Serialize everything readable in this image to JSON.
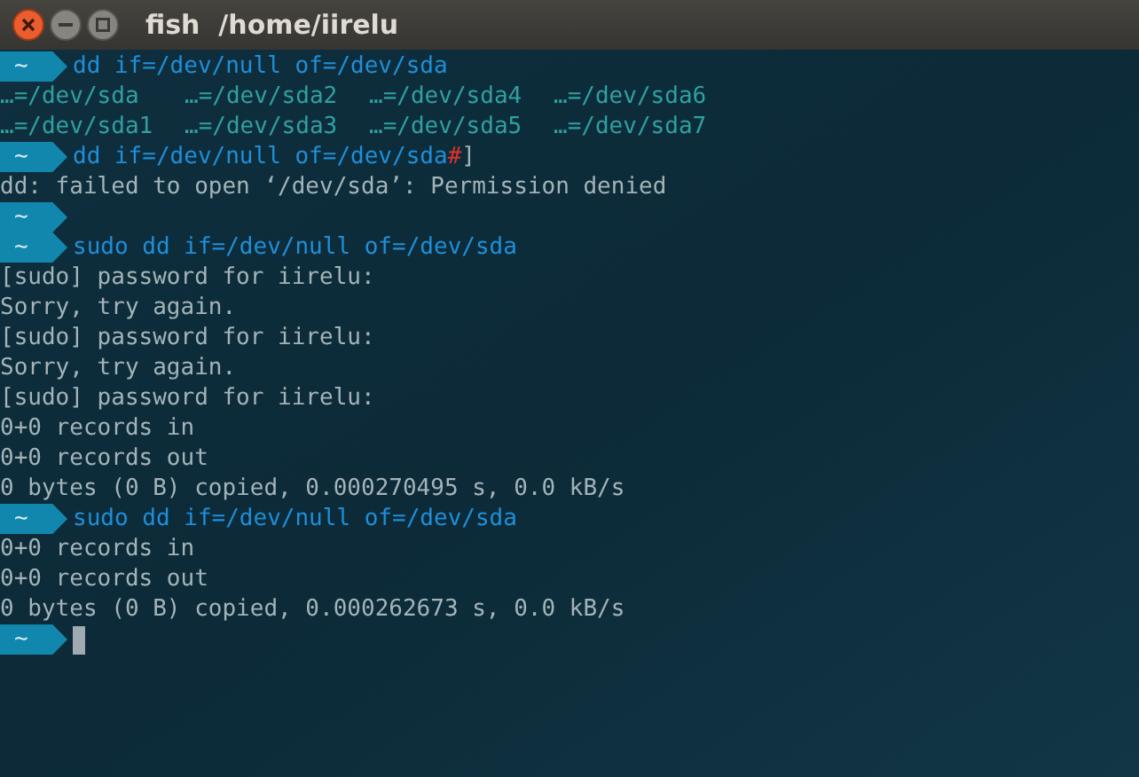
{
  "window": {
    "title": "fish  /home/iirelu"
  },
  "lines": [
    {
      "kind": "prompt",
      "dir": "~",
      "parts": [
        {
          "kind": "command",
          "text": "dd if=/dev/null of=/dev/sda"
        }
      ]
    },
    {
      "kind": "completions",
      "items": [
        "…=/dev/sda",
        "…=/dev/sda2",
        "…=/dev/sda4",
        "…=/dev/sda6"
      ]
    },
    {
      "kind": "completions",
      "items": [
        "…=/dev/sda1",
        "…=/dev/sda3",
        "…=/dev/sda5",
        "…=/dev/sda7"
      ]
    },
    {
      "kind": "prompt",
      "dir": "~",
      "parts": [
        {
          "kind": "command",
          "text": "dd if=/dev/null of=/dev/sda"
        },
        {
          "kind": "error",
          "text": "#"
        },
        {
          "kind": "plain",
          "text": "]"
        }
      ]
    },
    {
      "kind": "output",
      "text": "dd: failed to open ‘/dev/sda’: Permission denied"
    },
    {
      "kind": "prompt",
      "dir": "~"
    },
    {
      "kind": "prompt",
      "dir": "~",
      "parts": [
        {
          "kind": "command",
          "text": "sudo dd if=/dev/null of=/dev/sda"
        }
      ]
    },
    {
      "kind": "output",
      "text": "[sudo] password for iirelu:"
    },
    {
      "kind": "output",
      "text": "Sorry, try again."
    },
    {
      "kind": "output",
      "text": "[sudo] password for iirelu:"
    },
    {
      "kind": "output",
      "text": "Sorry, try again."
    },
    {
      "kind": "output",
      "text": "[sudo] password for iirelu:"
    },
    {
      "kind": "output",
      "text": "0+0 records in"
    },
    {
      "kind": "output",
      "text": "0+0 records out"
    },
    {
      "kind": "output",
      "text": "0 bytes (0 B) copied, 0.000270495 s, 0.0 kB/s"
    },
    {
      "kind": "prompt",
      "dir": "~",
      "parts": [
        {
          "kind": "command",
          "text": "sudo dd if=/dev/null of=/dev/sda"
        }
      ]
    },
    {
      "kind": "output",
      "text": "0+0 records in"
    },
    {
      "kind": "output",
      "text": "0+0 records out"
    },
    {
      "kind": "output",
      "text": "0 bytes (0 B) copied, 0.000262673 s, 0.0 kB/s"
    },
    {
      "kind": "prompt",
      "dir": "~",
      "cursor": true
    }
  ]
}
